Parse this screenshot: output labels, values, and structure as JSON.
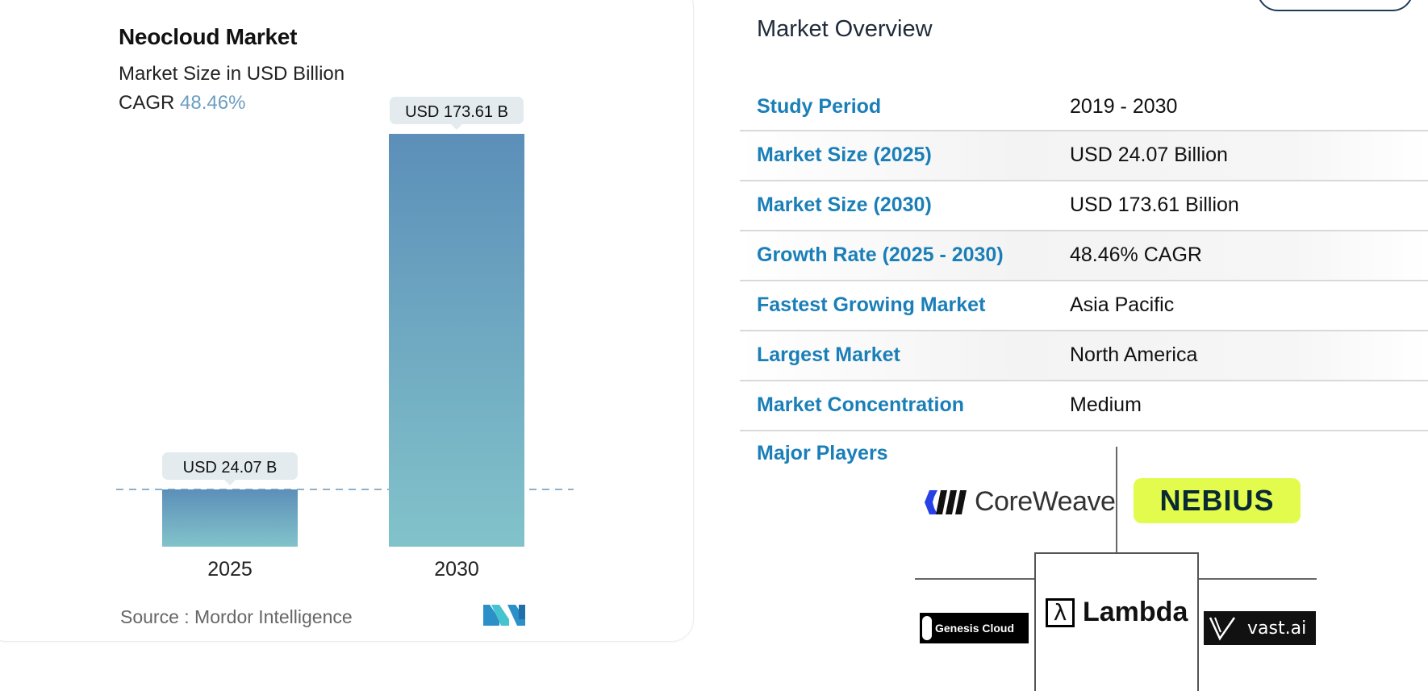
{
  "chart_card": {
    "title": "Neocloud Market",
    "subtitle": "Market Size in USD Billion",
    "cagr_label": "CAGR",
    "cagr_value": "48.46%",
    "source": "Source :  Mordor Intelligence",
    "logo_text": "MI"
  },
  "chart_data": {
    "type": "bar",
    "title": "Neocloud Market",
    "subtitle": "Market Size in USD Billion",
    "categories": [
      "2025",
      "2030"
    ],
    "values": [
      24.07,
      173.61
    ],
    "data_labels": [
      "USD 24.07 B",
      "USD 173.61 B"
    ],
    "xlabel": "",
    "ylabel": "Market Size in USD Billion",
    "ylim": [
      0,
      173.61
    ],
    "reference_line": 24.07,
    "grid": false,
    "colors": {
      "bar_top": "#5c8fb9",
      "bar_bottom": "#82c3ca",
      "label_bg": "#e3ebef",
      "ref_line": "#6b96b8"
    }
  },
  "overview": {
    "title": "Market Overview",
    "rows": [
      {
        "label": "Study Period",
        "value": "2019 - 2030"
      },
      {
        "label": "Market Size (2025)",
        "value": "USD 24.07 Billion"
      },
      {
        "label": "Market Size (2030)",
        "value": "USD 173.61 Billion"
      },
      {
        "label": "Growth Rate (2025 - 2030)",
        "value": "48.46% CAGR"
      },
      {
        "label": "Fastest Growing Market",
        "value": "Asia Pacific"
      },
      {
        "label": "Largest Market",
        "value": "North America"
      },
      {
        "label": "Market Concentration",
        "value": "Medium"
      }
    ],
    "major_players_label": "Major Players",
    "players": [
      "CoreWeave",
      "NEBIUS",
      "Genesis Cloud",
      "Lambda",
      "vast.ai"
    ]
  },
  "colors": {
    "accent": "#1a7fb8",
    "nebius_bg": "#e2fb4d",
    "coreweave": "#2741e7"
  }
}
